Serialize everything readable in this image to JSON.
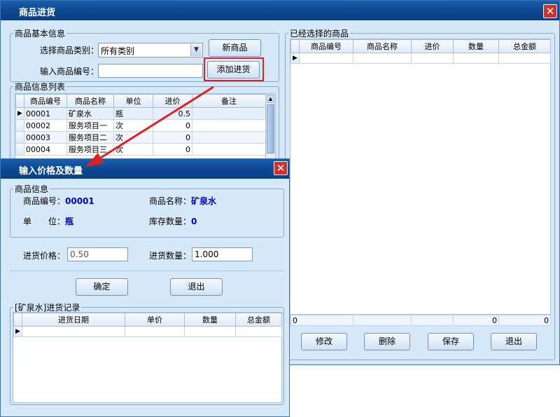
{
  "main": {
    "title": "商品进货",
    "close_glyph": "✕",
    "basic_info": {
      "legend": "商品基本信息",
      "category_label": "选择商品类别：",
      "category_value": "所有类别",
      "code_label": "输入商品编号：",
      "code_value": "",
      "new_product_button": "新商品",
      "add_purchase_button": "添加进货"
    },
    "product_list": {
      "legend": "商品信息列表",
      "headers": [
        "商品编号",
        "商品名称",
        "单位",
        "进价",
        "备注"
      ],
      "rows": [
        {
          "code": "00001",
          "name": "矿泉水",
          "unit": "瓶",
          "price": "0.5",
          "note": ""
        },
        {
          "code": "00002",
          "name": "服务项目一",
          "unit": "次",
          "price": "0",
          "note": ""
        },
        {
          "code": "00003",
          "name": "服务项目二",
          "unit": "次",
          "price": "0",
          "note": ""
        },
        {
          "code": "00004",
          "name": "服务项目三",
          "unit": "次",
          "price": "0",
          "note": ""
        }
      ]
    },
    "selected": {
      "legend": "已经选择的商品",
      "headers": [
        "商品编号",
        "商品名称",
        "进价",
        "数量",
        "总金额"
      ],
      "footer": {
        "code": "0",
        "name": "",
        "price": "",
        "qty": "0",
        "total": "0"
      },
      "buttons": {
        "edit": "修改",
        "delete": "删除",
        "save": "保存",
        "exit": "退出"
      }
    }
  },
  "dialog": {
    "title": "输入价格及数量",
    "close_glyph": "✕",
    "info_legend": "商品信息",
    "code_label": "商品编号：",
    "code_value": "00001",
    "name_label": "商品名称：",
    "name_value": "矿泉水",
    "unit_label": "单　　位：",
    "unit_value": "瓶",
    "stock_label": "库存数量：",
    "stock_value": "0",
    "price_label": "进货价格：",
    "price_value": "0.50",
    "qty_label": "进货数量：",
    "qty_value": "1.000",
    "ok_button": "确定",
    "exit_button": "退出",
    "records_legend": "[矿泉水]进货记录",
    "records_headers": [
      "进货日期",
      "单价",
      "数量",
      "总金额"
    ]
  },
  "colors": {
    "titlebar": "#0f4a92",
    "highlight_box": "#e02020",
    "arrow": "#e02020",
    "value_text": "#0000c8"
  }
}
